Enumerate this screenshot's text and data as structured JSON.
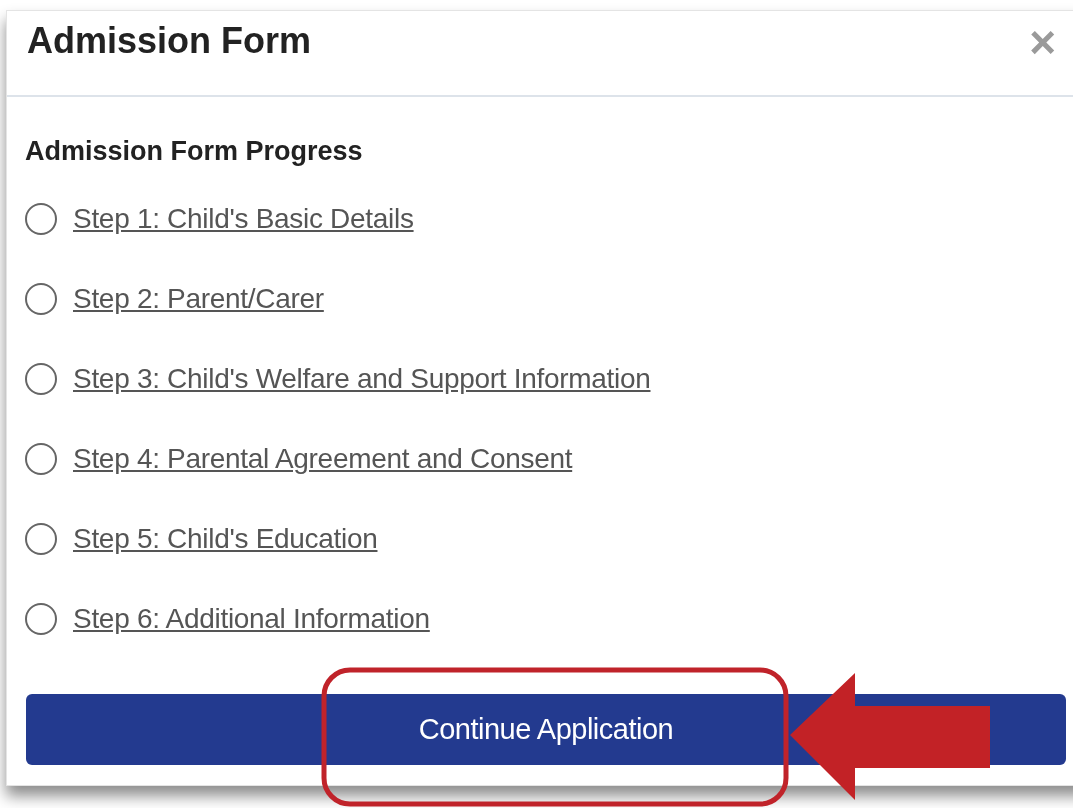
{
  "modal": {
    "title": "Admission Form",
    "close": "×"
  },
  "progress": {
    "heading": "Admission Form Progress",
    "steps": [
      {
        "label": "Step 1: Child's Basic Details",
        "checked": false
      },
      {
        "label": "Step 2: Parent/Carer",
        "checked": false
      },
      {
        "label": "Step 3: Child's Welfare and Support Information",
        "checked": false
      },
      {
        "label": "Step 4: Parental Agreement and Consent",
        "checked": false
      },
      {
        "label": "Step 5: Child's Education",
        "checked": false
      },
      {
        "label": "Step 6: Additional Information",
        "checked": false
      }
    ]
  },
  "button": {
    "label": "Continue Application"
  }
}
